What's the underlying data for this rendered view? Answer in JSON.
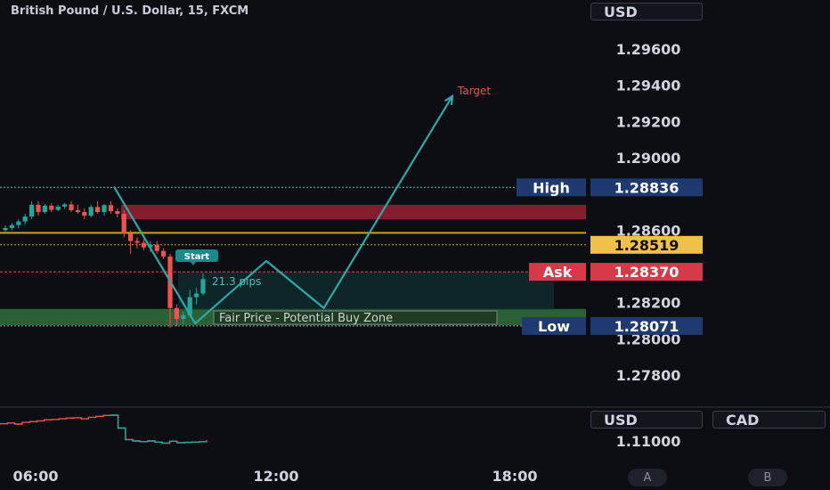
{
  "header": {
    "symbol_title": "British Pound / U.S. Dollar, 15, FXCM"
  },
  "currency_selector_main": "USD",
  "lower_pane": {
    "currency_left": "USD",
    "currency_right": "CAD",
    "price_label": "1.11000"
  },
  "nav_buttons": [
    "A",
    "B"
  ],
  "colors": {
    "background": "#0c0e14",
    "bull": "#26a69a",
    "bear": "#ef5350",
    "resistance_zone": "#8b2030",
    "buy_zone": "#2e6b3a",
    "teal_line": "#2fa8a8",
    "gold_line": "#c9a227",
    "ask_line": "#e0454f",
    "label_blue": "#1e3a6e",
    "label_gold": "#f0c04a",
    "label_red": "#d63a48"
  },
  "chart_data": {
    "type": "candlestick",
    "x_ticks": [
      "06:00",
      "12:00",
      "18:00"
    ],
    "y_ticks": [
      "1.29600",
      "1.29400",
      "1.29200",
      "1.29000",
      "1.28600",
      "1.28200",
      "1.28000",
      "1.27800"
    ],
    "y_range": [
      1.2765,
      1.2982
    ],
    "price_labels": {
      "high": {
        "label": "High",
        "value": "1.28836"
      },
      "current": {
        "value": "1.28519"
      },
      "ask": {
        "label": "Ask",
        "value": "1.28370"
      },
      "low": {
        "label": "Low",
        "value": "1.28071"
      }
    },
    "annotations": {
      "target": "Target",
      "start": "Start",
      "pips": "21.3 pips",
      "buy_zone": "Fair Price - Potential Buy Zone"
    },
    "zones": {
      "resistance": [
        1.2866,
        1.2874
      ],
      "buy_zone": [
        1.28075,
        1.28165
      ]
    },
    "lines": {
      "high": 1.28836,
      "gold": 1.28585,
      "current": 1.28519,
      "ask": 1.2837,
      "low": 1.28071
    },
    "candles": [
      {
        "o": 1.286,
        "h": 1.28625,
        "l": 1.28585,
        "c": 1.28612
      },
      {
        "o": 1.28612,
        "h": 1.2864,
        "l": 1.28598,
        "c": 1.28628
      },
      {
        "o": 1.28628,
        "h": 1.2866,
        "l": 1.2861,
        "c": 1.28648
      },
      {
        "o": 1.28648,
        "h": 1.2869,
        "l": 1.2863,
        "c": 1.28675
      },
      {
        "o": 1.28675,
        "h": 1.2876,
        "l": 1.2866,
        "c": 1.2874
      },
      {
        "o": 1.2874,
        "h": 1.2876,
        "l": 1.2868,
        "c": 1.287
      },
      {
        "o": 1.287,
        "h": 1.28745,
        "l": 1.2869,
        "c": 1.28735
      },
      {
        "o": 1.28735,
        "h": 1.28748,
        "l": 1.287,
        "c": 1.28712
      },
      {
        "o": 1.28712,
        "h": 1.2874,
        "l": 1.28705,
        "c": 1.2873
      },
      {
        "o": 1.2873,
        "h": 1.2875,
        "l": 1.28718,
        "c": 1.28742
      },
      {
        "o": 1.28742,
        "h": 1.2876,
        "l": 1.287,
        "c": 1.2871
      },
      {
        "o": 1.2871,
        "h": 1.2874,
        "l": 1.2869,
        "c": 1.287
      },
      {
        "o": 1.287,
        "h": 1.2872,
        "l": 1.2866,
        "c": 1.2868
      },
      {
        "o": 1.2868,
        "h": 1.2874,
        "l": 1.2867,
        "c": 1.28728
      },
      {
        "o": 1.28728,
        "h": 1.2876,
        "l": 1.2869,
        "c": 1.287
      },
      {
        "o": 1.287,
        "h": 1.28745,
        "l": 1.2868,
        "c": 1.28738
      },
      {
        "o": 1.28738,
        "h": 1.2876,
        "l": 1.2869,
        "c": 1.28705
      },
      {
        "o": 1.28705,
        "h": 1.2872,
        "l": 1.2867,
        "c": 1.2869
      },
      {
        "o": 1.2869,
        "h": 1.2871,
        "l": 1.2856,
        "c": 1.2858
      },
      {
        "o": 1.2858,
        "h": 1.286,
        "l": 1.2847,
        "c": 1.2854
      },
      {
        "o": 1.2854,
        "h": 1.2856,
        "l": 1.285,
        "c": 1.2853
      },
      {
        "o": 1.2853,
        "h": 1.2855,
        "l": 1.2849,
        "c": 1.28505
      },
      {
        "o": 1.28505,
        "h": 1.2854,
        "l": 1.2848,
        "c": 1.2852
      },
      {
        "o": 1.2852,
        "h": 1.2854,
        "l": 1.2847,
        "c": 1.28485
      },
      {
        "o": 1.28485,
        "h": 1.285,
        "l": 1.2844,
        "c": 1.28455
      },
      {
        "o": 1.28455,
        "h": 1.2847,
        "l": 1.2806,
        "c": 1.2817
      },
      {
        "o": 1.2817,
        "h": 1.2819,
        "l": 1.2807,
        "c": 1.2811
      },
      {
        "o": 1.2811,
        "h": 1.2815,
        "l": 1.2808,
        "c": 1.2813
      },
      {
        "o": 1.2813,
        "h": 1.2827,
        "l": 1.2812,
        "c": 1.2823
      },
      {
        "o": 1.2823,
        "h": 1.2828,
        "l": 1.2819,
        "c": 1.2825
      },
      {
        "o": 1.2825,
        "h": 1.2836,
        "l": 1.2824,
        "c": 1.2833
      }
    ],
    "path_projection": [
      {
        "t": 0.0,
        "p": 1.2884
      },
      {
        "t": 0.24,
        "p": 1.28085
      },
      {
        "t": 0.45,
        "p": 1.2843
      },
      {
        "t": 0.62,
        "p": 1.2817
      },
      {
        "t": 1.0,
        "p": 1.2934
      }
    ],
    "lower_series": [
      1.1112,
      1.11125,
      1.11118,
      1.1113,
      1.11135,
      1.1114,
      1.11148,
      1.1115,
      1.11155,
      1.1116,
      1.11162,
      1.11155,
      1.11165,
      1.11172,
      1.11178,
      1.1118,
      1.1109,
      1.1101,
      1.11,
      1.10995,
      1.11,
      1.10992,
      1.10985,
      1.10998,
      1.10988,
      1.1099,
      1.10992,
      1.10995,
      1.11005
    ]
  }
}
